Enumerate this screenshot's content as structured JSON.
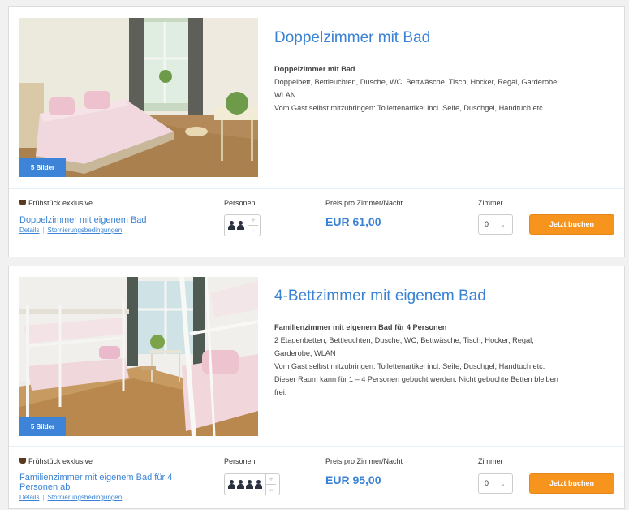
{
  "rooms": [
    {
      "title": "Doppelzimmer mit Bad",
      "images_badge": "5 Bilder",
      "desc_heading": "Doppelzimmer mit Bad",
      "desc_lines": [
        "Doppelbett, Bettleuchten, Dusche, WC, Bettwäsche, Tisch, Hocker, Regal, Garderobe,",
        "WLAN",
        "Vom Gast selbst mitzubringen: Toilettenartikel incl. Seife, Duschgel, Handtuch etc."
      ],
      "meal": "Frühstück exklusive",
      "rate_name": "Doppelzimmer mit eigenem Bad",
      "details_link": "Details",
      "cancel_link": "Stornierungsbedingungen",
      "persons_label": "Personen",
      "persons_count": 2,
      "price_label": "Preis pro Zimmer/Nacht",
      "price": "EUR 61,00",
      "rooms_label": "Zimmer",
      "rooms_value": "0",
      "book_label": "Jetzt buchen"
    },
    {
      "title": "4-Bettzimmer mit eigenem Bad",
      "images_badge": "5 Bilder",
      "desc_heading": "Familienzimmer mit eigenem Bad für 4 Personen",
      "desc_lines": [
        "2 Etagenbetten, Bettleuchten, Dusche, WC, Bettwäsche, Tisch, Hocker, Regal,",
        "Garderobe, WLAN",
        "Vom Gast selbst mitzubringen: Toilettenartikel incl. Seife, Duschgel, Handtuch etc.",
        "Dieser Raum kann für 1 – 4 Personen gebucht werden. Nicht gebuchte Betten bleiben",
        "frei."
      ],
      "meal": "Frühstück exklusive",
      "rate_name": "Familienzimmer mit eigenem Bad für 4 Personen ab",
      "details_link": "Details",
      "cancel_link": "Stornierungsbedingungen",
      "persons_label": "Personen",
      "persons_count": 4,
      "price_label": "Preis pro Zimmer/Nacht",
      "price": "EUR 95,00",
      "rooms_label": "Zimmer",
      "rooms_value": "0",
      "book_label": "Jetzt buchen"
    }
  ],
  "icons": {
    "stepper_plus": "+",
    "stepper_minus": "−",
    "chevron": "⌄"
  },
  "colors": {
    "accent_blue": "#3a82d4",
    "book_orange": "#f7941d",
    "badge_blue": "#3d84d8"
  }
}
